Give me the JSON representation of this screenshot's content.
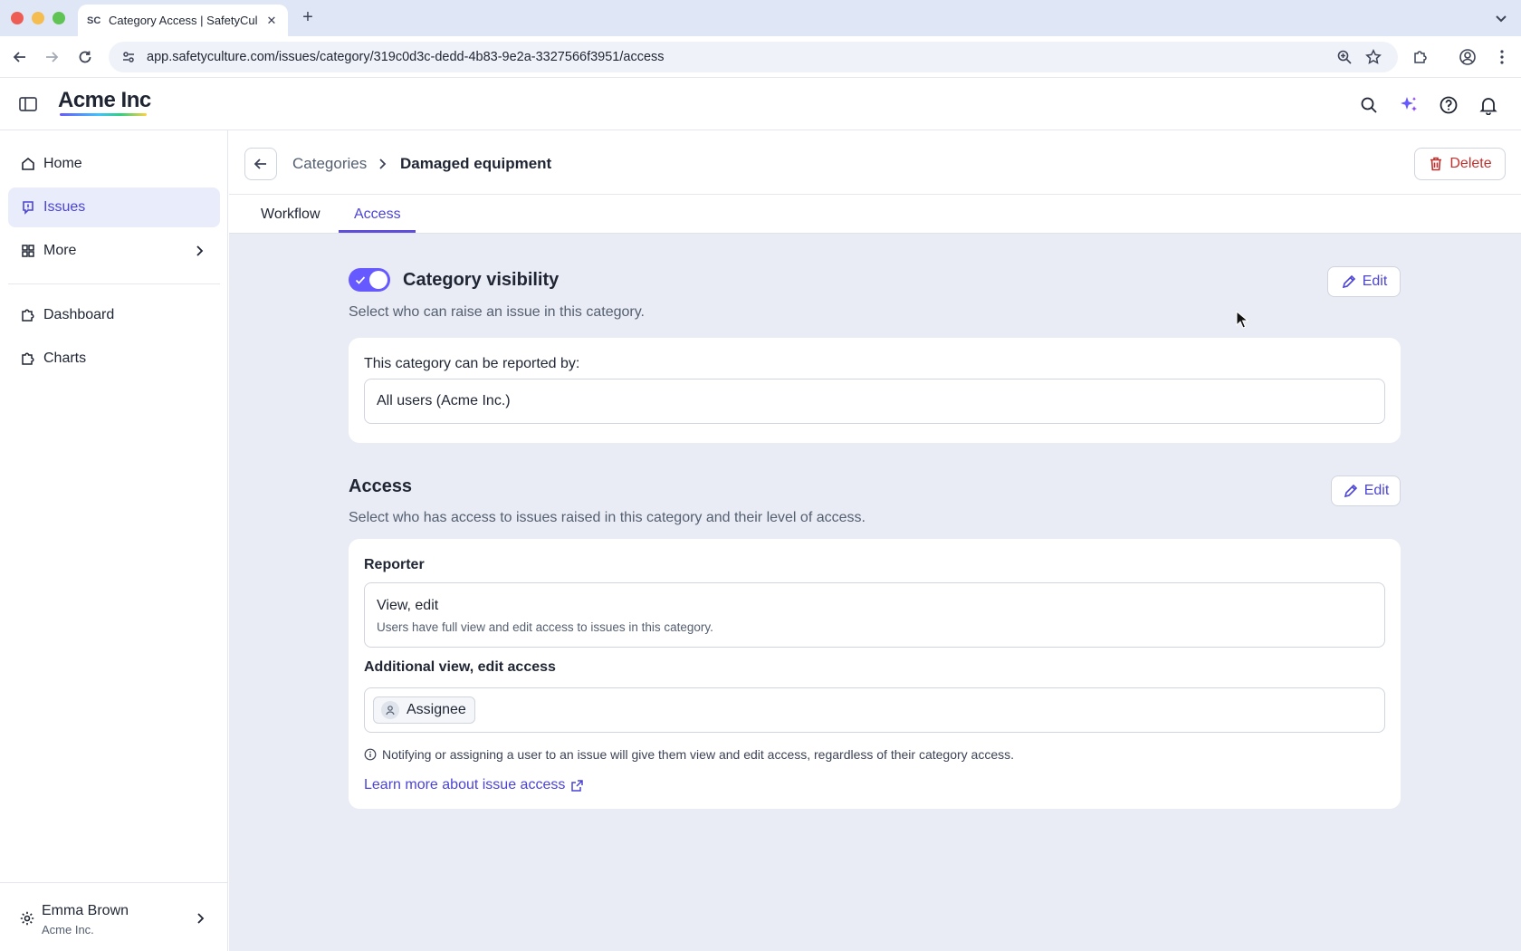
{
  "browser": {
    "tab_title": "Category Access | SafetyCulture",
    "favicon_text": "SC",
    "url": "app.safetyculture.com/issues/category/319c0d3c-dedd-4b83-9e2a-3327566f3951/access"
  },
  "header": {
    "brand": "Acme Inc"
  },
  "sidebar": {
    "items": [
      {
        "label": "Home",
        "icon": "home-icon"
      },
      {
        "label": "Issues",
        "icon": "issues-icon",
        "active": true
      },
      {
        "label": "More",
        "icon": "grid-icon"
      },
      {
        "label": "Dashboard",
        "icon": "puzzle-icon"
      },
      {
        "label": "Charts",
        "icon": "puzzle-icon"
      }
    ],
    "user": {
      "name": "Emma Brown",
      "org": "Acme Inc."
    }
  },
  "page": {
    "breadcrumb": {
      "parent": "Categories",
      "current": "Damaged equipment"
    },
    "delete_label": "Delete",
    "tabs": [
      {
        "label": "Workflow"
      },
      {
        "label": "Access",
        "active": true
      }
    ]
  },
  "visibility": {
    "enabled": true,
    "title": "Category visibility",
    "description": "Select who can raise an issue in this category.",
    "edit_label": "Edit",
    "field_label": "This category can be reported by:",
    "field_value": "All users (Acme Inc.)"
  },
  "access": {
    "title": "Access",
    "description": "Select who has access to issues raised in this category and their level of access.",
    "edit_label": "Edit",
    "reporter_label": "Reporter",
    "reporter_level": "View, edit",
    "reporter_desc": "Users have full view and edit access to issues in this category.",
    "additional_label": "Additional view, edit access",
    "chip_label": "Assignee",
    "note": "Notifying or assigning a user to an issue will give them view and edit access, regardless of their category access.",
    "learn_more": "Learn more about issue access"
  },
  "colors": {
    "accent": "#6559ff",
    "link": "#4b44d6",
    "danger": "#c0312d",
    "page_bg": "#e9ecf5"
  }
}
